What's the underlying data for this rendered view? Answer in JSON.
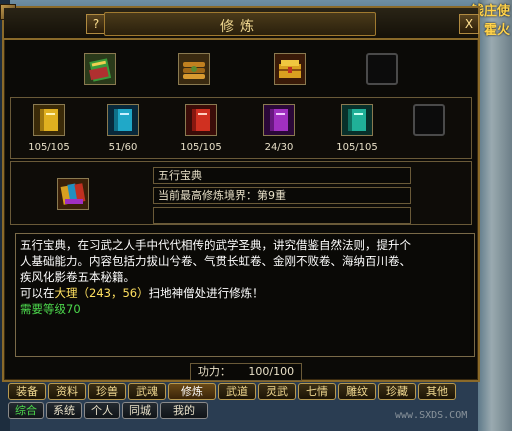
{
  "scene": {
    "top_right_text_1": "钱庄使",
    "top_right_text_2": "霍火"
  },
  "window": {
    "title": "修炼",
    "help_label": "?",
    "close_label": "X"
  },
  "top_slots": [
    {
      "name": "book-green-icon",
      "color": "#3a9a3a"
    },
    {
      "name": "scroll-bundle-icon",
      "color": "#c08020"
    },
    {
      "name": "golden-chest-icon",
      "color": "#d8a020"
    },
    {
      "name": "empty-slot",
      "color": ""
    }
  ],
  "skill_books": [
    {
      "icon": "yellow-book-icon",
      "color": "#e0b020",
      "count": "105/105"
    },
    {
      "icon": "cyan-book-icon",
      "color": "#20a8c8",
      "count": "51/60"
    },
    {
      "icon": "red-book-icon",
      "color": "#d03020",
      "count": "105/105"
    },
    {
      "icon": "purple-book-icon",
      "color": "#a030c0",
      "count": "24/30"
    },
    {
      "icon": "teal-book-icon",
      "color": "#20b098",
      "count": "105/105"
    },
    {
      "icon": "empty-slot",
      "color": "",
      "count": ""
    }
  ],
  "selected": {
    "icon": "wuxing-book-icon",
    "name": "五行宝典",
    "realm": "当前最高修炼境界：第9重",
    "extra": ""
  },
  "description": {
    "line1": "五行宝典，在习武之人手中代代相传的武学圣典，讲究借鉴自然法则，提升个",
    "line2": "人基础能力。内容包括力拔山兮卷、气贯长虹卷、金刚不败卷、海纳百川卷、",
    "line3": "疾风化影卷五本秘籍。",
    "where_prefix": "可以在",
    "where_location": "大理（243，56）",
    "where_suffix": "扫地神僧处进行修炼！",
    "requirement": "需要等级70"
  },
  "power": {
    "label": "功力：",
    "value": "100/100"
  },
  "tabs_row1": [
    "装备",
    "资料",
    "珍兽",
    "武魂",
    "修炼",
    "武道",
    "灵武",
    "七情",
    "雕纹",
    "珍藏",
    "其他"
  ],
  "tabs_row2": [
    "综合",
    "系统",
    "个人",
    "同城",
    "我的"
  ],
  "active_tab": "修炼",
  "watermark": "www.SXDS.COM"
}
